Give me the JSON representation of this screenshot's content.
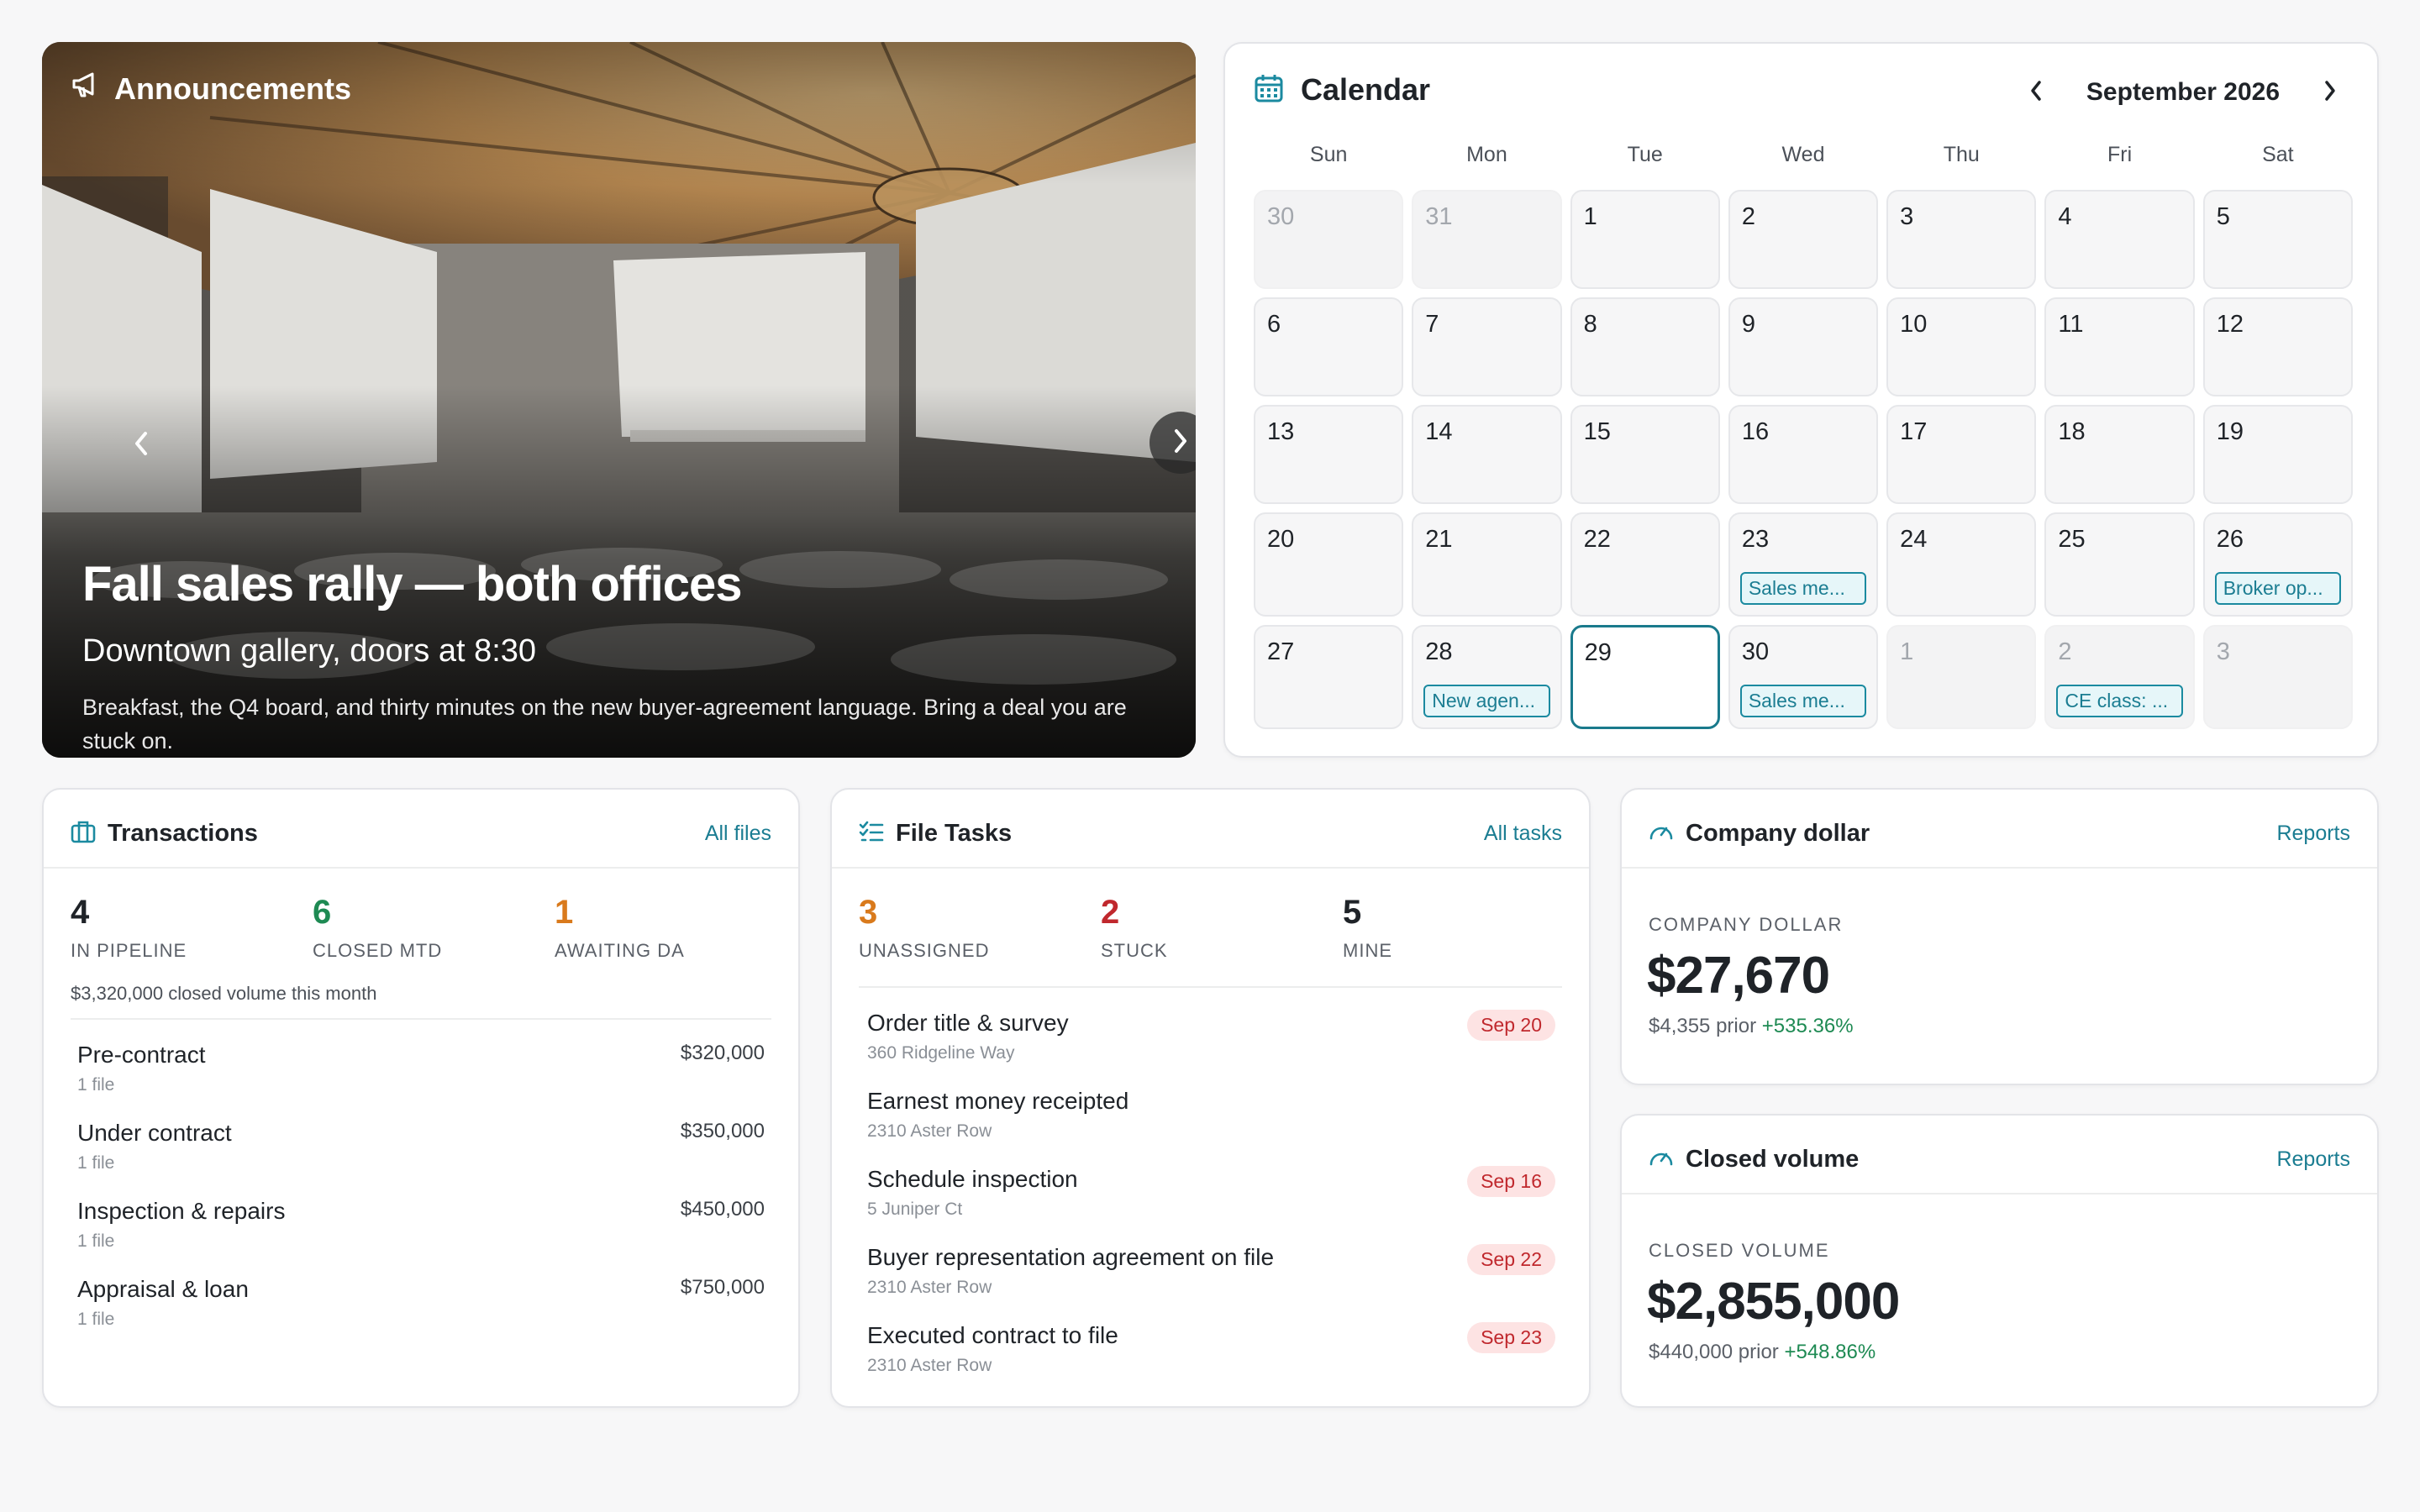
{
  "announcements": {
    "title": "Announcements",
    "headline": "Fall sales rally — both offices",
    "subhead": "Downtown gallery, doors at 8:30",
    "body": "Breakfast, the Q4 board, and thirty minutes on the new buyer-agreement language. Bring a deal you are stuck on.",
    "slide_count": 6,
    "active_slide": 1,
    "icons": {
      "header": "megaphone-icon",
      "prev": "chevron-left-icon",
      "next": "chevron-right-icon"
    }
  },
  "calendar": {
    "title": "Calendar",
    "month": "September 2026",
    "weekdays": [
      "Sun",
      "Mon",
      "Tue",
      "Wed",
      "Thu",
      "Fri",
      "Sat"
    ],
    "days": [
      {
        "n": "30",
        "muted": true
      },
      {
        "n": "31",
        "muted": true
      },
      {
        "n": "1"
      },
      {
        "n": "2"
      },
      {
        "n": "3"
      },
      {
        "n": "4"
      },
      {
        "n": "5"
      },
      {
        "n": "6"
      },
      {
        "n": "7"
      },
      {
        "n": "8"
      },
      {
        "n": "9"
      },
      {
        "n": "10"
      },
      {
        "n": "11"
      },
      {
        "n": "12"
      },
      {
        "n": "13"
      },
      {
        "n": "14"
      },
      {
        "n": "15"
      },
      {
        "n": "16"
      },
      {
        "n": "17"
      },
      {
        "n": "18"
      },
      {
        "n": "19"
      },
      {
        "n": "20"
      },
      {
        "n": "21"
      },
      {
        "n": "22"
      },
      {
        "n": "23",
        "event": "Sales me..."
      },
      {
        "n": "24"
      },
      {
        "n": "25"
      },
      {
        "n": "26",
        "event": "Broker op..."
      },
      {
        "n": "27"
      },
      {
        "n": "28",
        "event": "New agen..."
      },
      {
        "n": "29",
        "today": true
      },
      {
        "n": "30",
        "event": "Sales me..."
      },
      {
        "n": "1",
        "muted": true
      },
      {
        "n": "2",
        "muted": true,
        "event": "CE class: ..."
      },
      {
        "n": "3",
        "muted": true
      }
    ],
    "accent": "#1b8aa0"
  },
  "transactions": {
    "title": "Transactions",
    "link": "All files",
    "stats": [
      {
        "value": "4",
        "label": "IN PIPELINE",
        "color": "#1f2328"
      },
      {
        "value": "6",
        "label": "CLOSED MTD",
        "color": "#1e8a53"
      },
      {
        "value": "1",
        "label": "AWAITING DA",
        "color": "#d97a1c"
      }
    ],
    "volume_note": "$3,320,000 closed volume this month",
    "stages": [
      {
        "name": "Pre-contract",
        "count": "1 file",
        "amount": "$320,000"
      },
      {
        "name": "Under contract",
        "count": "1 file",
        "amount": "$350,000"
      },
      {
        "name": "Inspection & repairs",
        "count": "1 file",
        "amount": "$450,000"
      },
      {
        "name": "Appraisal & loan",
        "count": "1 file",
        "amount": "$750,000"
      }
    ]
  },
  "file_tasks": {
    "title": "File Tasks",
    "link": "All tasks",
    "stats": [
      {
        "value": "3",
        "label": "UNASSIGNED",
        "color": "#d97a1c"
      },
      {
        "value": "2",
        "label": "STUCK",
        "color": "#c0282d"
      },
      {
        "value": "5",
        "label": "MINE",
        "color": "#1f2328"
      }
    ],
    "tasks": [
      {
        "name": "Order title & survey",
        "address": "360 Ridgeline Way",
        "due": "Sep 20"
      },
      {
        "name": "Earnest money receipted",
        "address": "2310 Aster Row",
        "due": ""
      },
      {
        "name": "Schedule inspection",
        "address": "5 Juniper Ct",
        "due": "Sep 16"
      },
      {
        "name": "Buyer representation agreement on file",
        "address": "2310 Aster Row",
        "due": "Sep 22"
      },
      {
        "name": "Executed contract to file",
        "address": "2310 Aster Row",
        "due": "Sep 23"
      }
    ]
  },
  "company_dollar": {
    "title": "Company dollar",
    "link": "Reports",
    "label": "COMPANY DOLLAR",
    "value": "$27,670",
    "prior": "$4,355 prior",
    "change": "+535.36%"
  },
  "closed_volume": {
    "title": "Closed volume",
    "link": "Reports",
    "label": "CLOSED VOLUME",
    "value": "$2,855,000",
    "prior": "$440,000 prior",
    "change": "+548.86%"
  }
}
